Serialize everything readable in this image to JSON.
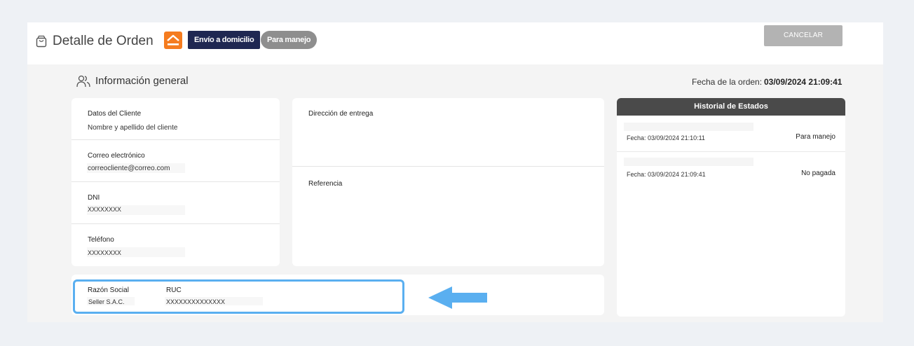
{
  "header": {
    "title": "Detalle de Orden",
    "shipping_badge": "Envío a domicilio",
    "status_badge": "Para manejo",
    "cancel_label": "CANCELAR"
  },
  "general": {
    "section_title": "Información general",
    "order_date_label": "Fecha de la orden:",
    "order_date_value": "03/09/2024 21:09:41"
  },
  "client": {
    "rows": [
      {
        "label": "Datos del Cliente",
        "value": "Nombre y apellido del cliente"
      },
      {
        "label": "Correo electrónico",
        "value": "correocliente@correo.com"
      },
      {
        "label": "DNI",
        "value": "XXXXXXXX"
      },
      {
        "label": "Teléfono",
        "value": "XXXXXXXX"
      }
    ]
  },
  "address": {
    "delivery_label": "Dirección de entrega",
    "reference_label": "Referencia"
  },
  "history": {
    "title": "Historial de Estados",
    "entries": [
      {
        "date": "Fecha: 03/09/2024 21:10:11",
        "status": "Para manejo"
      },
      {
        "date": "Fecha: 03/09/2024 21:09:41",
        "status": "No pagada"
      }
    ]
  },
  "billing": {
    "business_name_label": "Razón Social",
    "business_name_value": "Seller S.A.C.",
    "ruc_label": "RUC",
    "ruc_value": "XXXXXXXXXXXXXX"
  },
  "colors": {
    "highlight": "#5aaff0",
    "brand_orange": "#f57c1f",
    "navy": "#1f2752"
  }
}
